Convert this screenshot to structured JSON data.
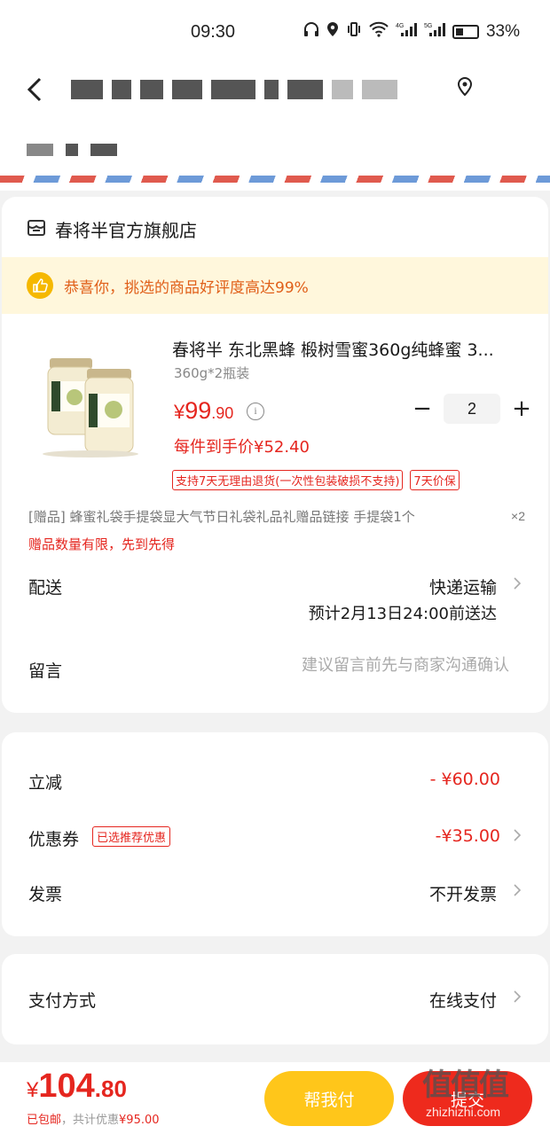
{
  "status_bar": {
    "time": "09:30",
    "battery": "33%",
    "network_1": "4G",
    "network_2": "5G"
  },
  "header": {
    "back_icon": "chevron-left-icon",
    "location_icon": "location-pin-icon"
  },
  "shop": {
    "name": "春将半官方旗舰店",
    "icon": "store-icon"
  },
  "notice": {
    "text": "恭喜你，挑选的商品好评度高达99%"
  },
  "product": {
    "title": "春将半 东北黑蜂 椴树雪蜜360g纯蜂蜜 3...",
    "spec": "360g*2瓶装",
    "price_yen": "¥",
    "price_int": "99",
    "price_dec": ".90",
    "info_icon": "i",
    "quantity": "2",
    "minus": "−",
    "plus": "+",
    "unit_price": "每件到手价¥52.40",
    "tags": [
      "支持7天无理由退货(一次性包装破损不支持)",
      "7天价保"
    ],
    "gift": "[赠品]  蜂蜜礼袋手提袋显大气节日礼袋礼品礼赠品链接 手提袋1个",
    "gift_qty": "×2",
    "gift_limit": "赠品数量有限，先到先得"
  },
  "delivery": {
    "label": "配送",
    "value": "快递运输",
    "eta": "预计2月13日24:00前送达"
  },
  "message": {
    "label": "留言",
    "placeholder": "建议留言前先与商家沟通确认"
  },
  "discounts": {
    "instant_label": "立减",
    "instant_value": "- ¥60.00",
    "coupon_label": "优惠券",
    "coupon_tag": "已选推荐优惠",
    "coupon_value": "-¥35.00",
    "invoice_label": "发票",
    "invoice_value": "不开发票"
  },
  "payment": {
    "label": "支付方式",
    "value": "在线支付"
  },
  "bottom": {
    "yen": "¥",
    "total_int": "104",
    "total_dec": ".80",
    "shipping": "已包邮",
    "saving": "，共计优惠",
    "saving_amount": "¥95.00",
    "help_pay": "帮我付",
    "submit": "提交",
    "watermark_logo": "值值值",
    "watermark_url": "zhizhizhi.com"
  },
  "colors": {
    "accent_red": "#e5261f",
    "help_yellow": "#ffc61a",
    "notice_orange": "#e0601a"
  }
}
